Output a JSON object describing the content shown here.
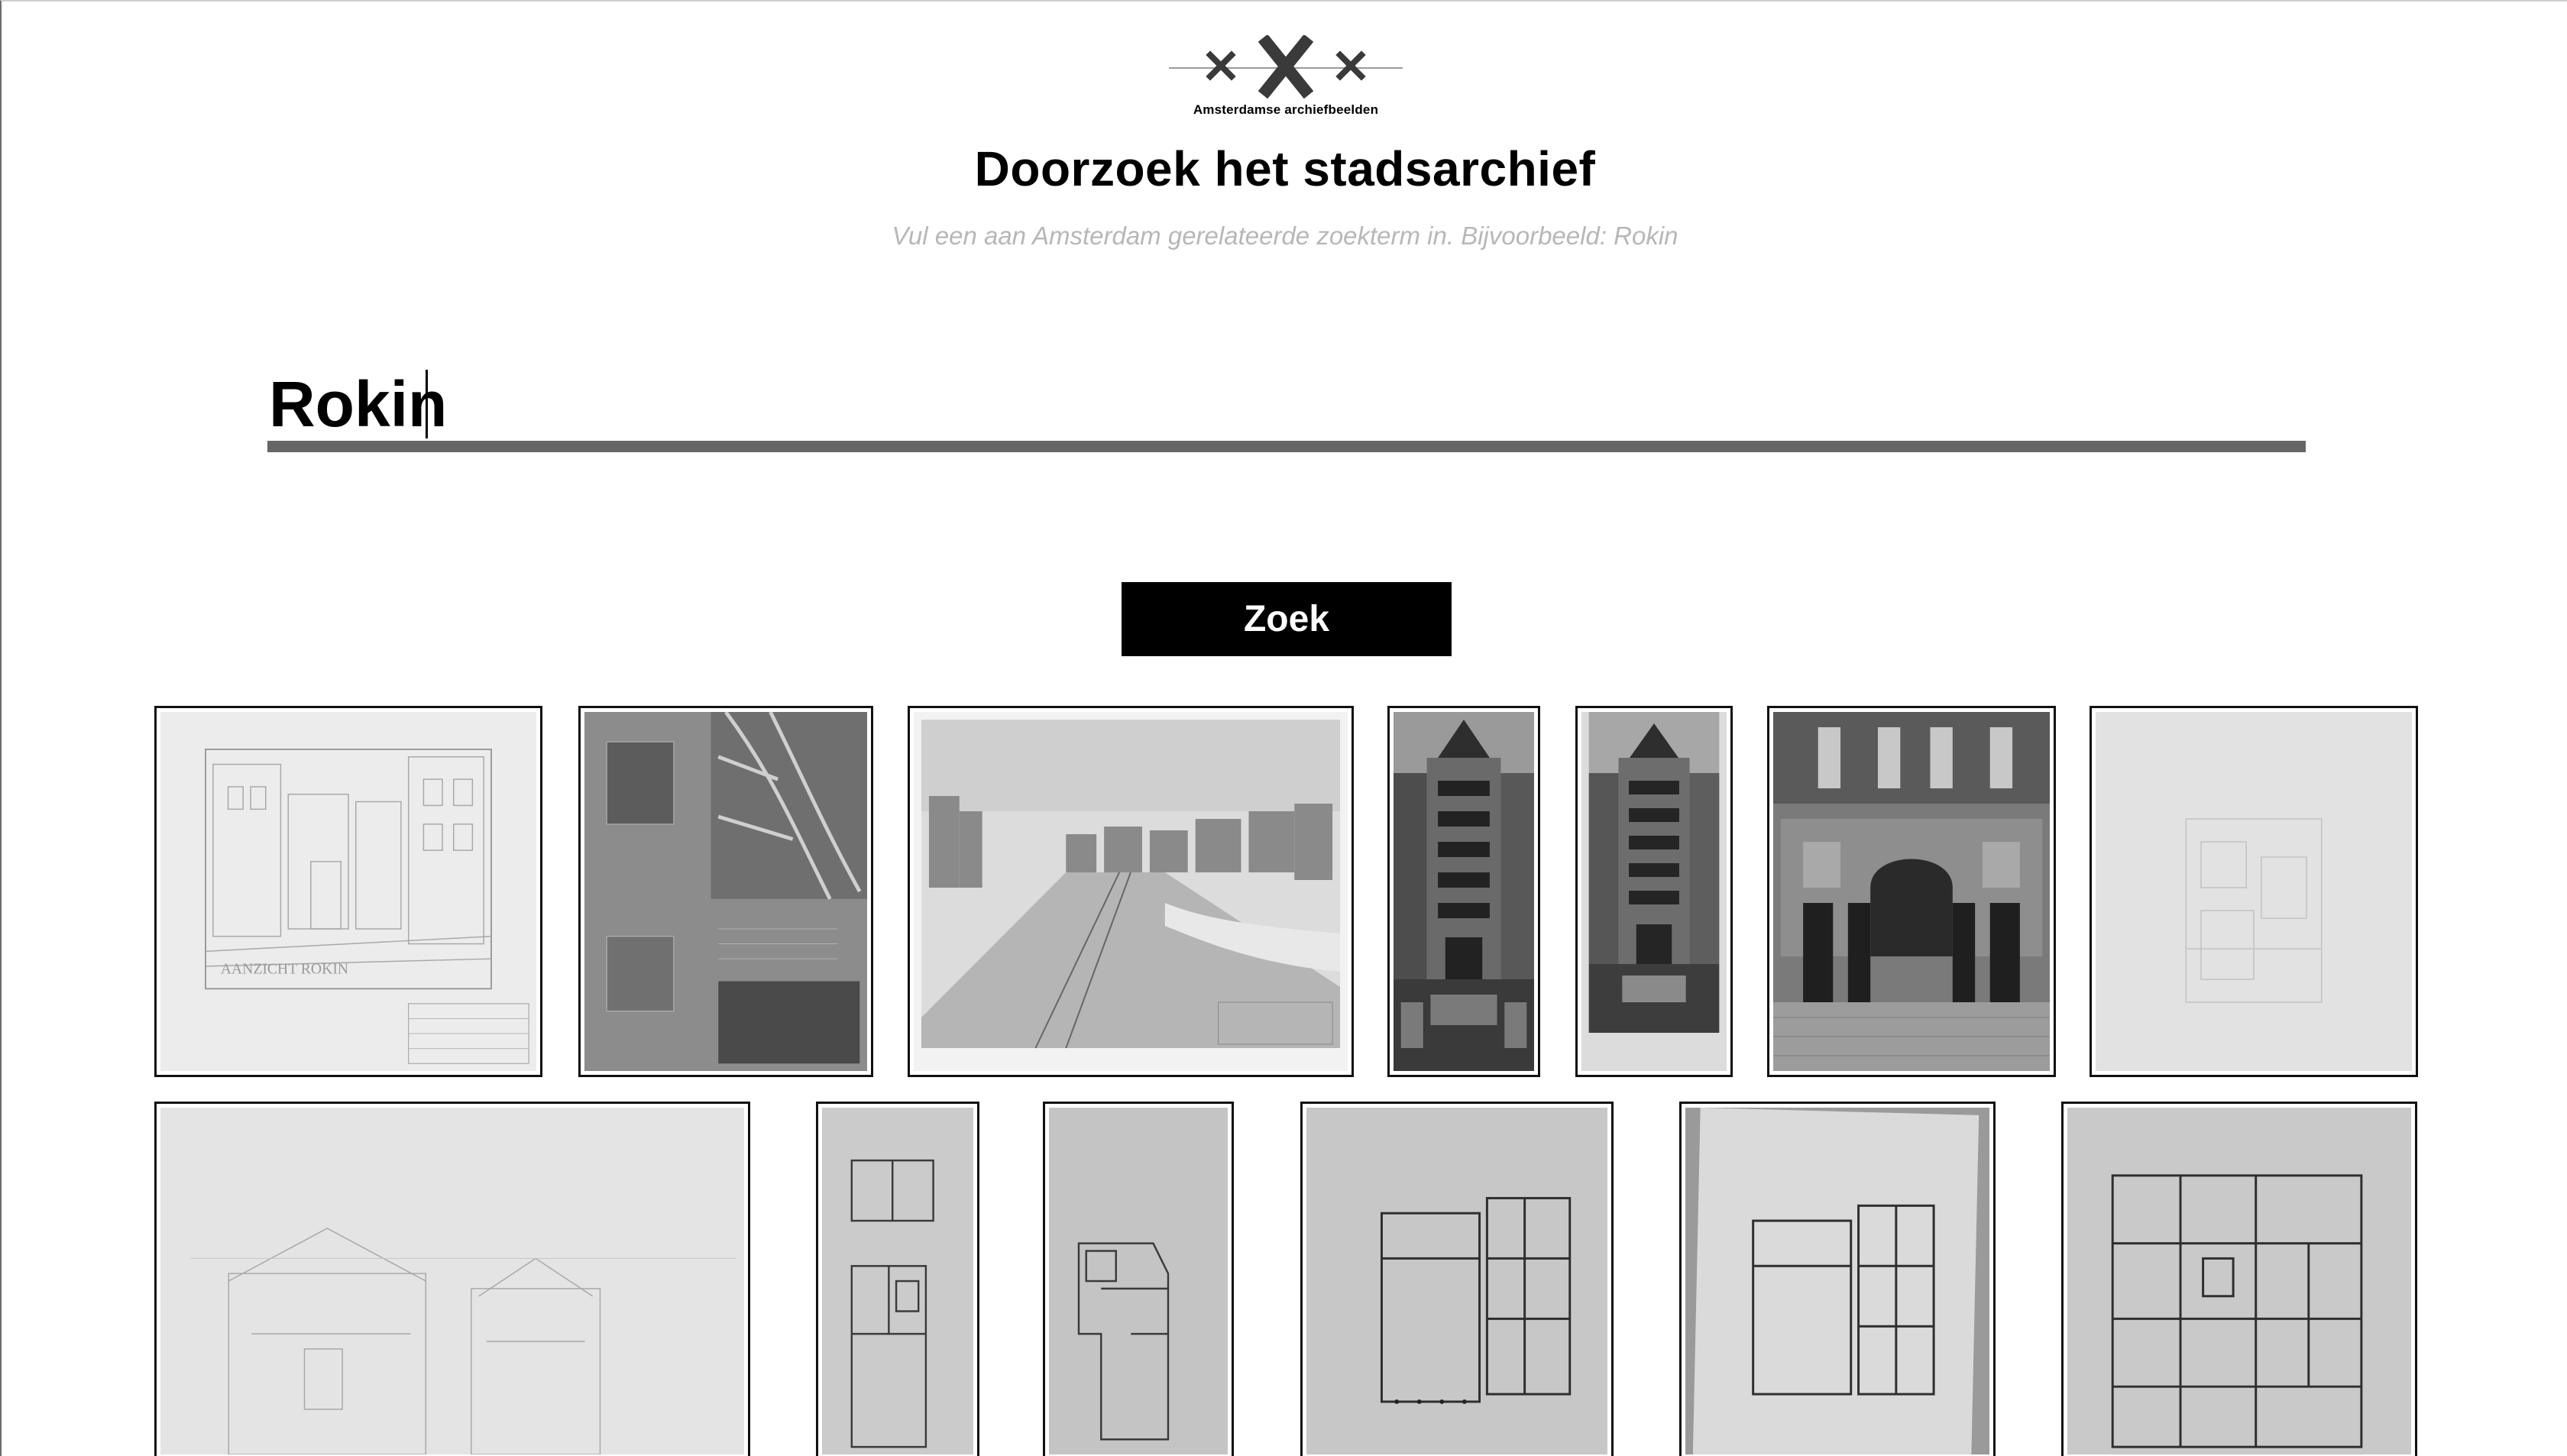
{
  "logo": {
    "icon": "triple-cross-logo",
    "text": "Amsterdamse archiefbeelden"
  },
  "header": {
    "title": "Doorzoek het stadsarchief",
    "subtitle": "Vul een aan Amsterdam gerelateerde zoekterm in. Bijvoorbeeld: Rokin"
  },
  "search": {
    "value": "Rokin",
    "button_label": "Zoek"
  },
  "results": {
    "row1": [
      {
        "kind": "elevation-drawing",
        "caption": "AANZICHT ROKIN"
      },
      {
        "kind": "technical-sheet-with-map"
      },
      {
        "kind": "street-perspective-drawing"
      },
      {
        "kind": "building-facade-photo"
      },
      {
        "kind": "building-facade-photo"
      },
      {
        "kind": "entrance-photo"
      },
      {
        "kind": "faded-floor-plan"
      }
    ],
    "row2": [
      {
        "kind": "section-drawing"
      },
      {
        "kind": "floor-plan-narrow"
      },
      {
        "kind": "floor-plan-narrow"
      },
      {
        "kind": "floor-plan"
      },
      {
        "kind": "floor-plan"
      },
      {
        "kind": "floor-plan-large"
      }
    ]
  }
}
